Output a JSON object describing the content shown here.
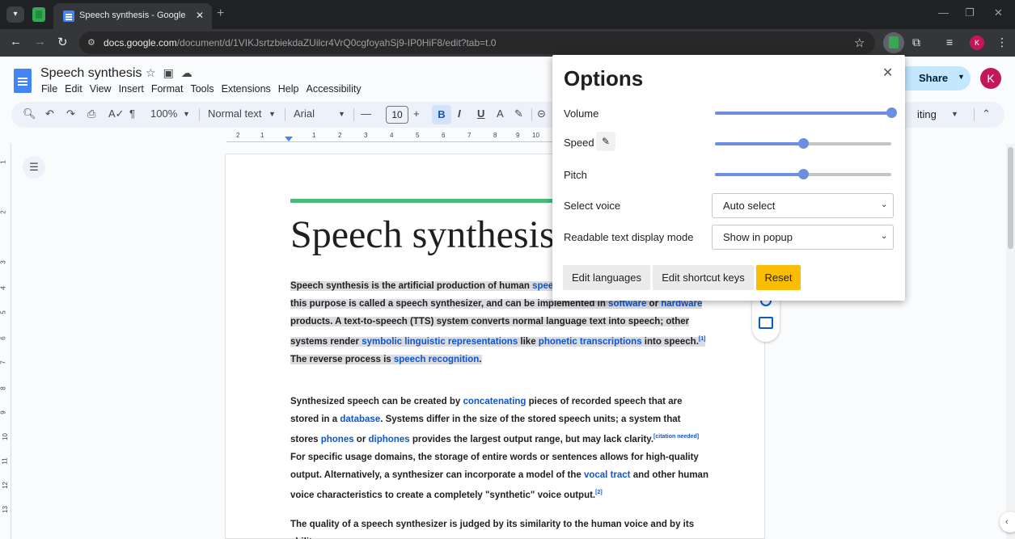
{
  "browser": {
    "tab_title": "Speech synthesis - Google Doc",
    "tab_close": "✕",
    "new_tab": "+",
    "url_host": "docs.google.com",
    "url_path": "/document/d/1VIKJsrtzbiekdaZUilcr4VrQ0cgfoyahSj9-IP0HiF8/edit?tab=t.0",
    "profile_initial": "K"
  },
  "docs": {
    "title": "Speech synthesis",
    "menu": [
      "File",
      "Edit",
      "View",
      "Insert",
      "Format",
      "Tools",
      "Extensions",
      "Help",
      "Accessibility"
    ],
    "share_label": "Share",
    "user_initial": "K",
    "toolbar": {
      "zoom": "100%",
      "style": "Normal text",
      "font": "Arial",
      "font_size": "10",
      "mode_label": "iting"
    },
    "ruler_numbers": [
      "2",
      "1",
      "1",
      "2",
      "3",
      "4",
      "5",
      "6",
      "7",
      "8",
      "9",
      "10"
    ],
    "vruler_numbers": [
      "1",
      "2",
      "3",
      "4",
      "5",
      "6",
      "7",
      "8",
      "9",
      "10",
      "11",
      "12",
      "13"
    ]
  },
  "document": {
    "heading": "Speech synthesis",
    "p1": {
      "t1": "Speech synthesis is the artificial production of human ",
      "l1": "speech",
      "t2": ". A computer system used for this purpose is called a speech synthesizer, and can be implemented in ",
      "l2": "software",
      "t3": " or ",
      "l3": "hardware",
      "t4": " products. A text-to-speech (TTS) system converts normal language text into speech; other systems render ",
      "l4": "symbolic linguistic representations",
      "t5": " like ",
      "l5": "phonetic transcriptions",
      "t6": " into speech.",
      "sup1": "[1]",
      "t7": " The reverse process is ",
      "l6": "speech recognition",
      "t8": "."
    },
    "p2": {
      "t1": "Synthesized speech can be created by ",
      "l1": "concatenating",
      "t2": " pieces of recorded speech that are stored in a ",
      "l2": "database",
      "t3": ". Systems differ in the size of the stored speech units; a system that stores ",
      "l3": "phones",
      "t4": " or ",
      "l4": "diphones",
      "t5": " provides the largest output range, but may lack clarity.",
      "sup1": "[citation needed]",
      "t6": " For specific usage domains, the storage of entire words or sentences allows for high-quality output. Alternatively, a synthesizer can incorporate a model of the ",
      "l5": "vocal tract",
      "t7": " and other human voice characteristics to create a completely \"synthetic\" voice output.",
      "sup2": "[2]"
    },
    "p3": {
      "t1": "The quality of a speech synthesizer is judged by its similarity to the human voice and by its ability"
    }
  },
  "options_popup": {
    "title": "Options",
    "close": "✕",
    "volume_label": "Volume",
    "volume_level": 1.0,
    "speed_label": "Speed",
    "speed_level": 0.5,
    "pitch_label": "Pitch",
    "pitch_level": 0.5,
    "voice_label": "Select voice",
    "voice_value": "Auto select",
    "display_label": "Readable text display mode",
    "display_value": "Show in popup",
    "edit_languages": "Edit languages",
    "edit_shortcuts": "Edit shortcut keys",
    "reset": "Reset"
  },
  "icons": {
    "accent": "#6c8ee0",
    "reset_color": "#fbbc04",
    "share_color": "#c2e7ff"
  }
}
